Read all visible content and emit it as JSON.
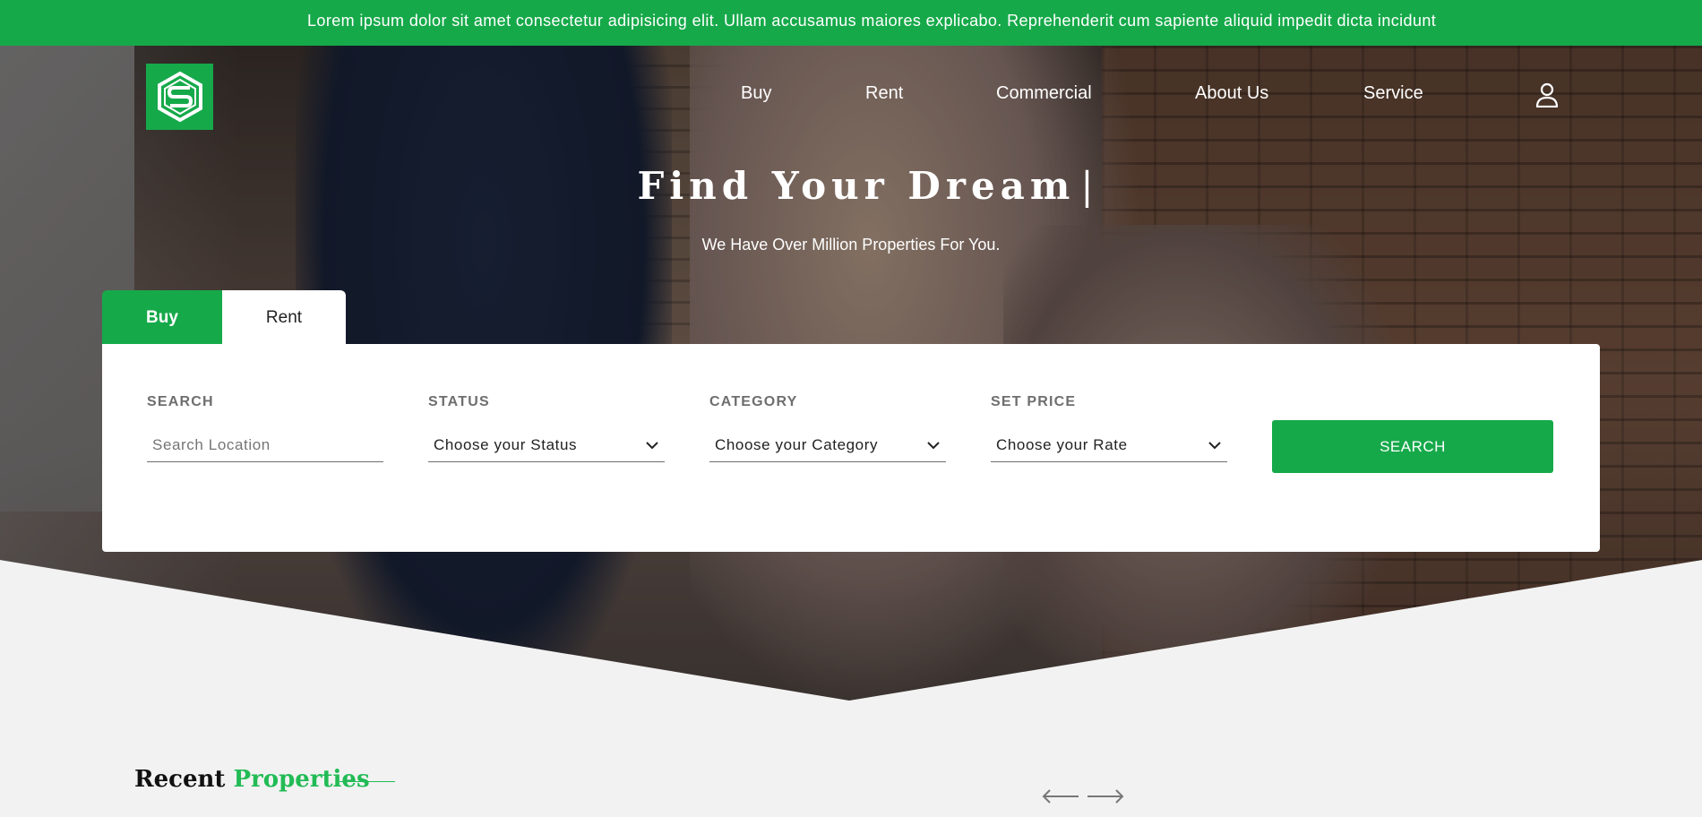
{
  "marquee": {
    "text": "Lorem ipsum dolor sit amet consectetur adipisicing elit. Ullam accusamus maiores explicabo. Reprehenderit cum sapiente aliquid impedit dicta incidunt"
  },
  "header": {
    "logo_icon": "shield-s-logo-icon",
    "nav": {
      "buy": "Buy",
      "rent": "Rent",
      "commercial": "Commercial",
      "about": "About Us",
      "service": "Service"
    },
    "account_icon": "user-icon"
  },
  "hero": {
    "title": "Find Your Dream",
    "caret": "|",
    "subtitle": "We Have Over Million Properties For You."
  },
  "tabs": {
    "buy": "Buy",
    "rent": "Rent",
    "active": "Buy"
  },
  "search_form": {
    "search": {
      "label": "SEARCH",
      "placeholder": "Search Location"
    },
    "status": {
      "label": "STATUS",
      "value": "Choose your Status"
    },
    "category": {
      "label": "CATEGORY",
      "value": "Choose your Category"
    },
    "price": {
      "label": "SET PRICE",
      "value": "Choose your Rate"
    },
    "button": "SEARCH"
  },
  "recent": {
    "title_part1": "Recent",
    "title_part2": "Properties",
    "prev_icon": "arrow-left-icon",
    "next_icon": "arrow-right-icon"
  },
  "colors": {
    "brand_green": "#16a94a",
    "accent_green": "#22bb55",
    "page_bg": "#f2f2f2"
  }
}
